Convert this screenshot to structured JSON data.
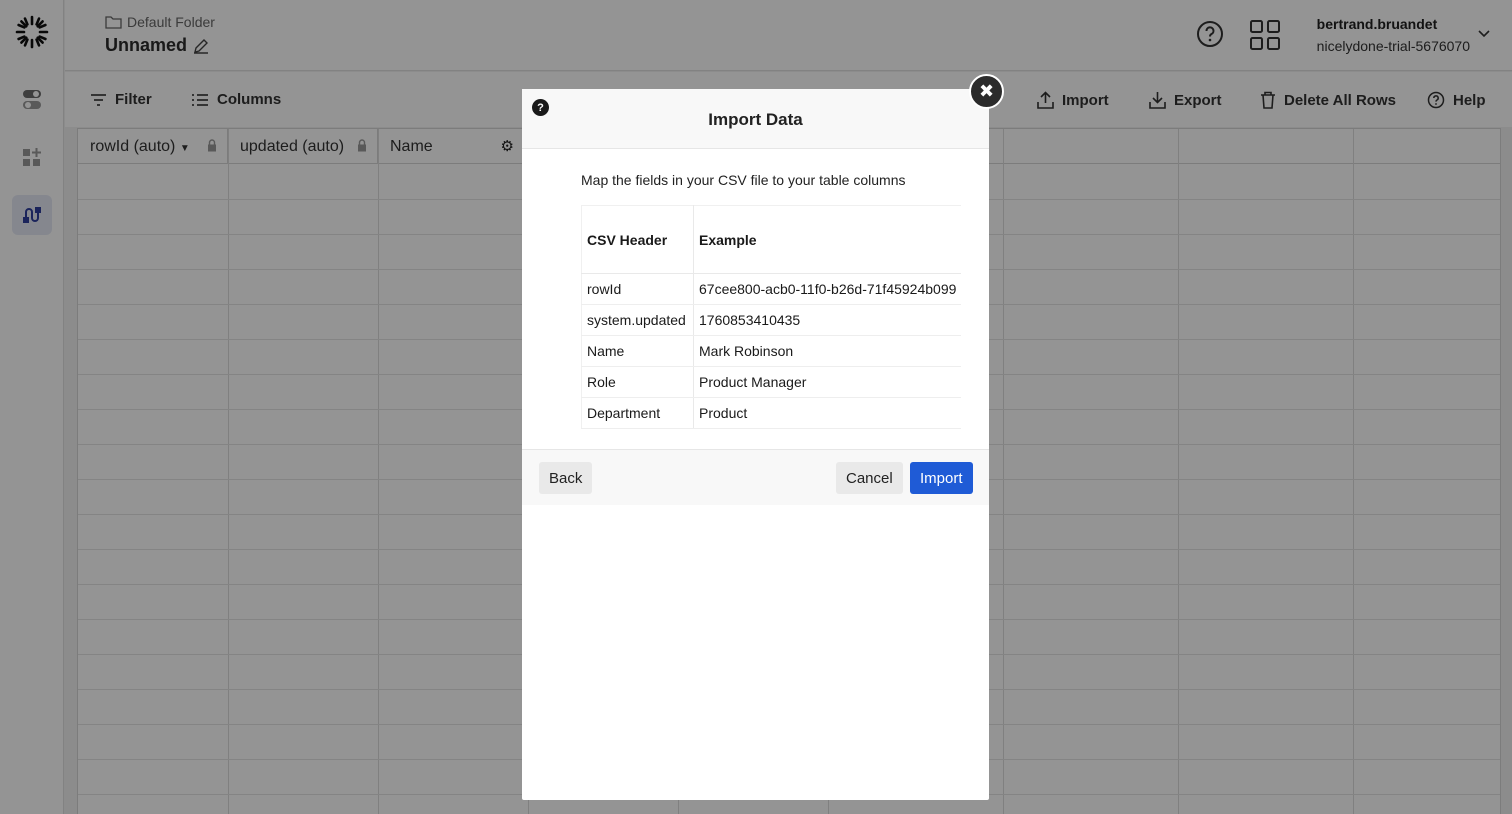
{
  "header": {
    "folder": "Default Folder",
    "title": "Unnamed",
    "user_name": "bertrand.bruandet",
    "org": "nicelydone-trial-5676070"
  },
  "toolbar": {
    "filter": "Filter",
    "columns": "Columns",
    "import": "Import",
    "export": "Export",
    "delete_all": "Delete All Rows",
    "help": "Help"
  },
  "grid": {
    "columns": [
      "rowId (auto)",
      "updated (auto)",
      "Name"
    ]
  },
  "modal": {
    "title": "Import Data",
    "help_glyph": "?",
    "close_glyph": "✖",
    "intro": "Map the fields in your CSV file to your table columns",
    "table_headers": [
      "CSV Header",
      "Example"
    ],
    "rows": [
      {
        "header": "rowId",
        "example": "67cee800-acb0-11f0-b26d-71f45924b099"
      },
      {
        "header": "system.updated",
        "example": "1760853410435"
      },
      {
        "header": "Name",
        "example": "Mark Robinson"
      },
      {
        "header": "Role",
        "example": "Product Manager"
      },
      {
        "header": "Department",
        "example": "Product"
      }
    ],
    "back": "Back",
    "cancel": "Cancel",
    "import": "Import"
  },
  "colors": {
    "primary": "#1f5bd6",
    "overlay": "rgba(0,0,0,0.42)"
  },
  "icons": [
    "logo-icon",
    "toggle-icon",
    "add-widget-icon",
    "flow-icon",
    "folder-icon",
    "pencil-icon",
    "help-circle-icon",
    "grid-apps-icon",
    "chevron-down-icon",
    "filter-icon",
    "columns-icon",
    "upload-icon",
    "download-icon",
    "trash-icon",
    "lock-icon",
    "gear-icon",
    "sort-caret-icon",
    "close-icon"
  ]
}
